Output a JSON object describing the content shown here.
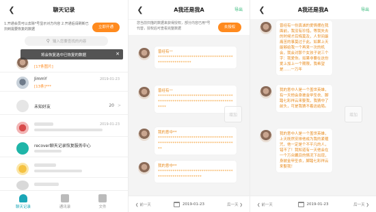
{
  "panel1": {
    "title": "聊天记录",
    "notice": "1.开通会员可以去除*号显示对方内容 2.开通后请刷新已扫到需要恢复的数据",
    "open_button": "立即开通",
    "search_placeholder": "输入您要查找的内容",
    "toast": "将会恢复选中已恢复的数据",
    "items": [
      {
        "name": "[17条图片]",
        "time": "",
        "sub": ""
      },
      {
        "name": "JimmY",
        "sub": "[13条]***",
        "time": "2019-01-23"
      },
      {
        "name": "未知好友",
        "count": "20",
        "arrow": ">"
      },
      {
        "name": "",
        "time": "2019-01-23"
      },
      {
        "name": "recover聊天记录恢复服务中心",
        "sub": "",
        "time": "2019-01-23"
      }
    ],
    "tabs": [
      {
        "label": "聊天记录",
        "active": true
      },
      {
        "label": "通讯录",
        "active": false
      },
      {
        "label": "文件",
        "active": false
      }
    ]
  },
  "panel2": {
    "title": "A我还是我A",
    "export": "导出",
    "hint": "您当前扫描的数据来获得授权，部分内容已用*号代替，授权后可查看完整数据",
    "auth_button": "去授权",
    "messages": [
      {
        "head": "曾经有一",
        "body": "****************************************************"
      },
      {
        "head": "曾经有一",
        "body": "****************************************************************************"
      },
      {
        "head": "我的意中**",
        "body": "**************************************************************************"
      },
      {
        "head": "我的意中**",
        "body": "*********************************************************"
      }
    ],
    "watermark": "增加",
    "prev": "前一天",
    "date": "2019-01-23",
    "next": "后一天"
  },
  "panel3": {
    "title": "A我还是我A",
    "export": "导出",
    "messages": [
      "曾经有一份真诚的爱情摆在我面前，我没有珍惜，等我失去的时候才后悔莫及，人世间最痛苦的事莫过于此。如果上天能够给我一个再来一次的机会，我会对那个女孩子说三个字：我爱你。如果非要在这份爱上加上一个期限，我希望是……一万年",
      "我的意中人是一个盖世英雄，有一天他会身披金甲圣衣、脚踏七彩祥云来娶我，我猜中了前头，可是我猜不着这结局。",
      "我的意中人是一个盖世英雄，上天既然安排他成为我的紧箍咒，他一定是个不平凡的人，错不了！我知道有一天他会在一个万众瞩目的情况下出现，身披金甲圣衣，脚踏七彩祥云来娶我！"
    ],
    "watermark": "增加",
    "prev": "前一天",
    "date": "2019-01-23",
    "next": "后一天"
  },
  "colors": {
    "accent": "#ff8a1e",
    "tab_active": "#1aa6b7",
    "export": "#2bb673"
  }
}
